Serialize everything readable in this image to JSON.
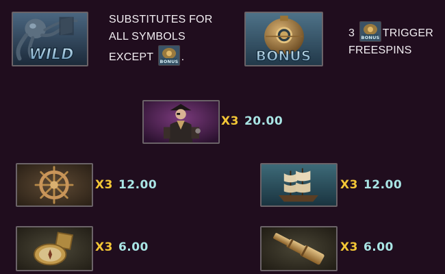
{
  "colors": {
    "background": "#200d1e",
    "multiplier": "#f3c636",
    "amount": "#a9e5e5",
    "text": "#f2eef2",
    "tile_border": "#6b6368"
  },
  "wild": {
    "icon": "octopus-wild-icon",
    "symbol_text": "WILD",
    "lines": [
      "SUBSTITUTES FOR",
      "ALL SYMBOLS",
      "EXCEPT"
    ],
    "line_end": ".",
    "inline_icon": "bonus-mini-icon"
  },
  "bonus": {
    "icon": "submarine-bonus-icon",
    "symbol_text": "BONUS",
    "count": "3",
    "trigger_word": "TRIGGER",
    "line2": "FREESPINS",
    "inline_icon": "bonus-mini-icon"
  },
  "paytable": [
    {
      "symbol": "pirate-captain-icon",
      "multiplier": "X3",
      "amount": "20.00"
    },
    {
      "symbol": "ship-wheel-icon",
      "multiplier": "X3",
      "amount": "12.00"
    },
    {
      "symbol": "sailing-ship-icon",
      "multiplier": "X3",
      "amount": "12.00"
    },
    {
      "symbol": "compass-icon",
      "multiplier": "X3",
      "amount": "6.00"
    },
    {
      "symbol": "spyglass-icon",
      "multiplier": "X3",
      "amount": "6.00"
    }
  ]
}
